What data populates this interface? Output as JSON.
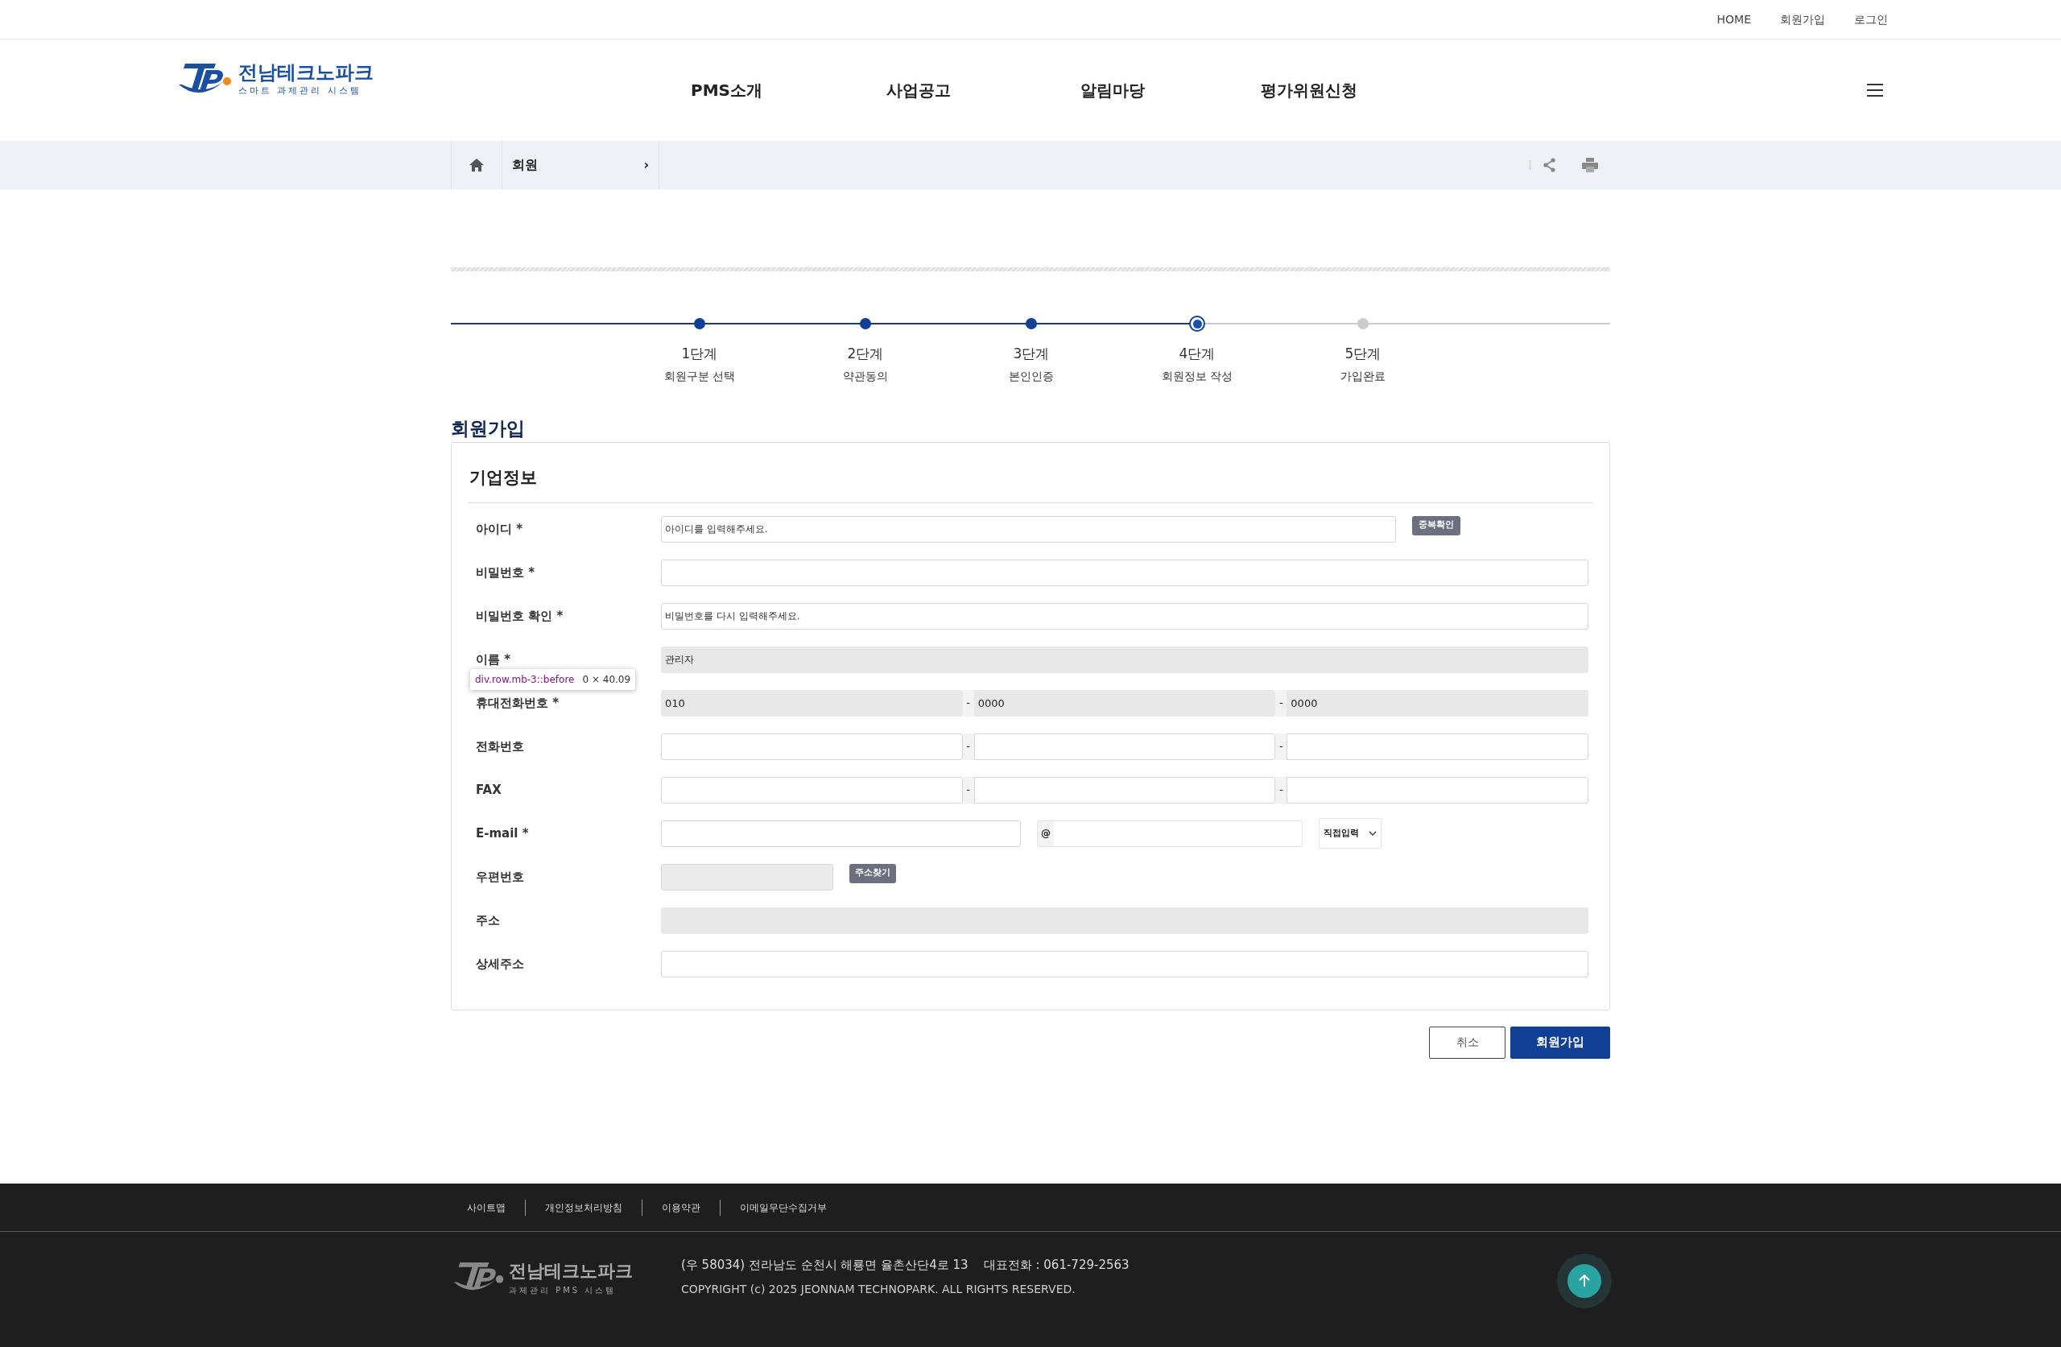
{
  "top_links": [
    "HOME",
    "회원가입",
    "로그인"
  ],
  "logo": {
    "title": "전남테크노파크",
    "subtitle": "스마트 과제관리 시스템"
  },
  "nav": [
    "PMS소개",
    "사업공고",
    "알림마당",
    "평가위원신청"
  ],
  "breadcrumb": {
    "current": "회원",
    "caret": "›"
  },
  "steps": [
    {
      "step": "1단계",
      "label": "회원구분 선택",
      "completed": true,
      "selected": false
    },
    {
      "step": "2단계",
      "label": "약관동의",
      "completed": true,
      "selected": false
    },
    {
      "step": "3단계",
      "label": "본인인증",
      "completed": true,
      "selected": false
    },
    {
      "step": "4단계",
      "label": "회원정보 작성",
      "completed": false,
      "selected": true
    },
    {
      "step": "5단계",
      "label": "가입완료",
      "completed": false,
      "selected": false
    }
  ],
  "page_title": "회원가입",
  "section_title": "기업정보",
  "fields": [
    {
      "kind": "text",
      "label": "아이디 *",
      "placeholder": "아이디를 입력해주세요.",
      "button": "중복확인",
      "disabled": false
    },
    {
      "kind": "text",
      "label": "비밀번호 *",
      "disabled": false
    },
    {
      "kind": "text",
      "label": "비밀번호 확인 *",
      "placeholder": "비밀번호를 다시 입력해주세요.",
      "disabled": false
    },
    {
      "kind": "text",
      "label": "이름 *",
      "value": "관리자",
      "disabled": true
    },
    {
      "kind": "phone",
      "label": "휴대전화번호 *",
      "values": [
        "010",
        "0000",
        "0000"
      ],
      "separator": "-",
      "disabled": true
    },
    {
      "kind": "phone",
      "label": "전화번호",
      "separator": "-",
      "disabled": false
    },
    {
      "kind": "phone",
      "label": "FAX",
      "separator": "-",
      "disabled": false
    },
    {
      "kind": "email",
      "label": "E-mail *",
      "at": "@",
      "select": "직접입력"
    },
    {
      "kind": "postal",
      "label": "우편번호",
      "button": "주소찾기",
      "disabled": true
    },
    {
      "kind": "locked",
      "label": "주소"
    },
    {
      "kind": "text",
      "label": "상세주소",
      "disabled": false
    }
  ],
  "devtools_tooltip": {
    "selector": "div.row.mb-3::before",
    "size": "0 × 40.09"
  },
  "buttons": {
    "cancel": "취소",
    "submit": "회원가입"
  },
  "footer": {
    "links": [
      "사이트맵",
      "개인정보처리방침",
      "이용약관",
      "이메일무단수집거부"
    ],
    "logo_title": "전남테크노파크",
    "logo_subtitle": "과제관리 PMS 시스템",
    "address": "(우 58034) 전라남도 순천시 해룡면 율촌산단4로 13    대표전화 : 061-729-2563",
    "copyright": "COPYRIGHT (c) 2025 JEONNAM TECHNOPARK. ALL RIGHTS RESERVED."
  }
}
